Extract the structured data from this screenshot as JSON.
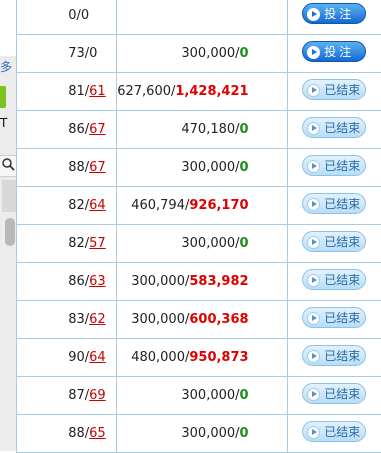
{
  "sidebar": {
    "more_label": "多",
    "mark_label": "T"
  },
  "rows": [
    {
      "ratio_a": "0/0",
      "ratio_b": "",
      "amount": "",
      "amount_extra": "",
      "extra_color": "",
      "action": "投注",
      "action_type": "bet"
    },
    {
      "ratio_a": "73/0",
      "ratio_b": "",
      "amount": "300,000/",
      "amount_extra": "0",
      "extra_color": "green",
      "action": "投注",
      "action_type": "bet"
    },
    {
      "ratio_a": "81/",
      "ratio_b": "61",
      "amount": "627,600/",
      "amount_extra": "1,428,421",
      "extra_color": "red",
      "action": "已结束",
      "action_type": "done"
    },
    {
      "ratio_a": "86/",
      "ratio_b": "67",
      "amount": "470,180/",
      "amount_extra": "0",
      "extra_color": "green",
      "action": "已结束",
      "action_type": "done"
    },
    {
      "ratio_a": "88/",
      "ratio_b": "67",
      "amount": "300,000/",
      "amount_extra": "0",
      "extra_color": "green",
      "action": "已结束",
      "action_type": "done"
    },
    {
      "ratio_a": "82/",
      "ratio_b": "64",
      "amount": "460,794/",
      "amount_extra": "926,170",
      "extra_color": "red",
      "action": "已结束",
      "action_type": "done"
    },
    {
      "ratio_a": "82/",
      "ratio_b": "57",
      "amount": "300,000/",
      "amount_extra": "0",
      "extra_color": "green",
      "action": "已结束",
      "action_type": "done"
    },
    {
      "ratio_a": "86/",
      "ratio_b": "63",
      "amount": "300,000/",
      "amount_extra": "583,982",
      "extra_color": "red",
      "action": "已结束",
      "action_type": "done"
    },
    {
      "ratio_a": "83/",
      "ratio_b": "62",
      "amount": "300,000/",
      "amount_extra": "600,368",
      "extra_color": "red",
      "action": "已结束",
      "action_type": "done"
    },
    {
      "ratio_a": "90/",
      "ratio_b": "64",
      "amount": "480,000/",
      "amount_extra": "950,873",
      "extra_color": "red",
      "action": "已结束",
      "action_type": "done"
    },
    {
      "ratio_a": "87/",
      "ratio_b": "69",
      "amount": "300,000/",
      "amount_extra": "0",
      "extra_color": "green",
      "action": "已结束",
      "action_type": "done"
    },
    {
      "ratio_a": "88/",
      "ratio_b": "65",
      "amount": "300,000/",
      "amount_extra": "0",
      "extra_color": "green",
      "action": "已结束",
      "action_type": "done"
    }
  ]
}
